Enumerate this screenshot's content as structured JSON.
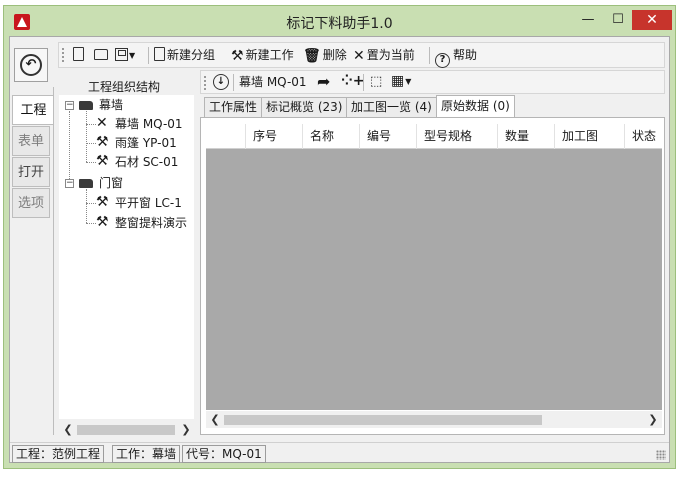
{
  "window": {
    "title": "标记下料助手1.0",
    "controls": {
      "minimize": "—",
      "maximize": "☐",
      "close": "✕"
    }
  },
  "sidebar": {
    "back_icon": "back-arrow-icon",
    "tabs": [
      {
        "label": "工程",
        "active": true
      },
      {
        "label": "表单",
        "active": false
      },
      {
        "label": "打开",
        "active": false
      },
      {
        "label": "选项",
        "active": false
      }
    ]
  },
  "toolbar": {
    "new_group": "新建分组",
    "new_work": "新建工作",
    "delete": "删除",
    "set_current": "置为当前",
    "help": "帮助"
  },
  "tree": {
    "header": "工程组织结构",
    "groups": [
      {
        "label": "幕墙",
        "items": [
          "幕墙 MQ-01",
          "雨篷 YP-01",
          "石材 SC-01"
        ]
      },
      {
        "label": "门窗",
        "items": [
          "平开窗 LC-1",
          "整窗提料演示"
        ]
      }
    ]
  },
  "work_toolbar": {
    "current": "幕墙 MQ-01"
  },
  "tabs": [
    {
      "label": "工作属性",
      "active": false
    },
    {
      "label": "标记概览 (23)",
      "active": false
    },
    {
      "label": "加工图一览 (4)",
      "active": false
    },
    {
      "label": "原始数据 (0)",
      "active": true
    }
  ],
  "grid": {
    "columns": [
      "",
      "序号",
      "名称",
      "编号",
      "型号规格",
      "数量",
      "加工图",
      "状态"
    ]
  },
  "status": {
    "project": "工程：范例工程",
    "work": "工作：幕墙",
    "code": "代号：MQ-01"
  },
  "colors": {
    "frame": "#c9dfb2",
    "close_button": "#c7342c",
    "grid_bg": "#a9a9a9"
  }
}
